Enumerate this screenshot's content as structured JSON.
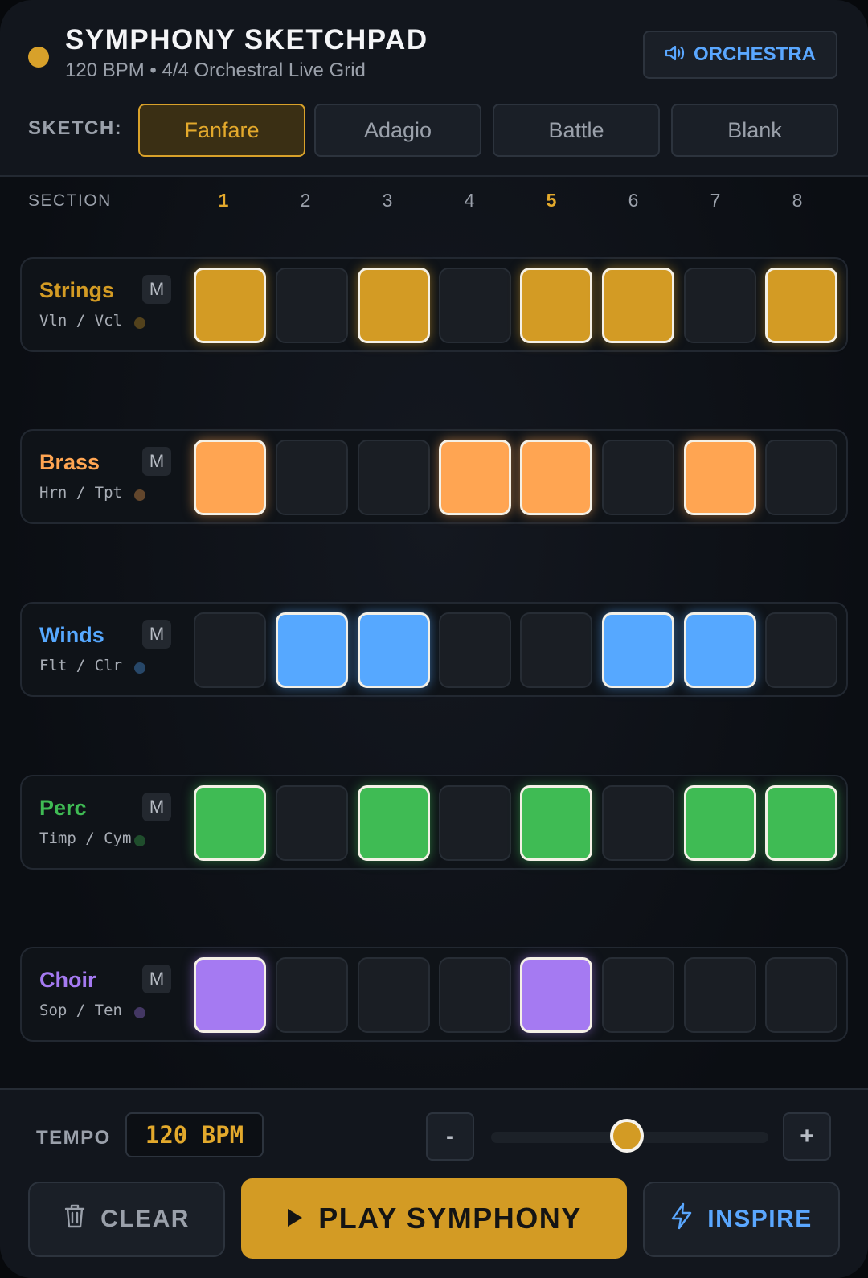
{
  "header": {
    "title": "SYMPHONY SKETCHPAD",
    "subtitle": "120 BPM • 4/4 Orchestral Live Grid",
    "mode_button": "ORCHESTRA"
  },
  "sketch": {
    "label": "SKETCH:",
    "presets": [
      "Fanfare",
      "Adagio",
      "Battle",
      "Blank"
    ],
    "active": "Fanfare"
  },
  "grid": {
    "section_label": "SECTION",
    "sections": [
      "1",
      "2",
      "3",
      "4",
      "5",
      "6",
      "7",
      "8"
    ],
    "highlighted_sections": [
      "1",
      "5"
    ],
    "tracks": [
      {
        "name": "Strings",
        "sub": "Vln / Vcl",
        "mute": "M",
        "color": "#d39b24",
        "pattern": [
          1,
          0,
          1,
          0,
          1,
          1,
          0,
          1
        ]
      },
      {
        "name": "Brass",
        "sub": "Hrn / Tpt",
        "mute": "M",
        "color": "#ffa552",
        "pattern": [
          1,
          0,
          0,
          1,
          1,
          0,
          1,
          0
        ]
      },
      {
        "name": "Winds",
        "sub": "Flt / Clr",
        "mute": "M",
        "color": "#56a8ff",
        "pattern": [
          0,
          1,
          1,
          0,
          0,
          1,
          1,
          0
        ]
      },
      {
        "name": "Perc",
        "sub": "Timp / Cym",
        "mute": "M",
        "color": "#3fbb54",
        "pattern": [
          1,
          0,
          1,
          0,
          1,
          0,
          1,
          1
        ]
      },
      {
        "name": "Choir",
        "sub": "Sop / Ten",
        "mute": "M",
        "color": "#a57af2",
        "pattern": [
          1,
          0,
          0,
          0,
          1,
          0,
          0,
          0
        ]
      }
    ]
  },
  "tempo": {
    "label": "TEMPO",
    "value": "120 BPM",
    "minus": "-",
    "plus": "+",
    "slider_level": 0.5
  },
  "actions": {
    "clear": "CLEAR",
    "play": "PLAY SYMPHONY",
    "inspire": "INSPIRE"
  },
  "icons": {
    "mode": "speaker-icon",
    "clear": "trash-icon",
    "play": "play-icon",
    "inspire": "lightning-icon"
  },
  "colors": {
    "accent": "#d39b24",
    "link": "#5aa7ff"
  }
}
